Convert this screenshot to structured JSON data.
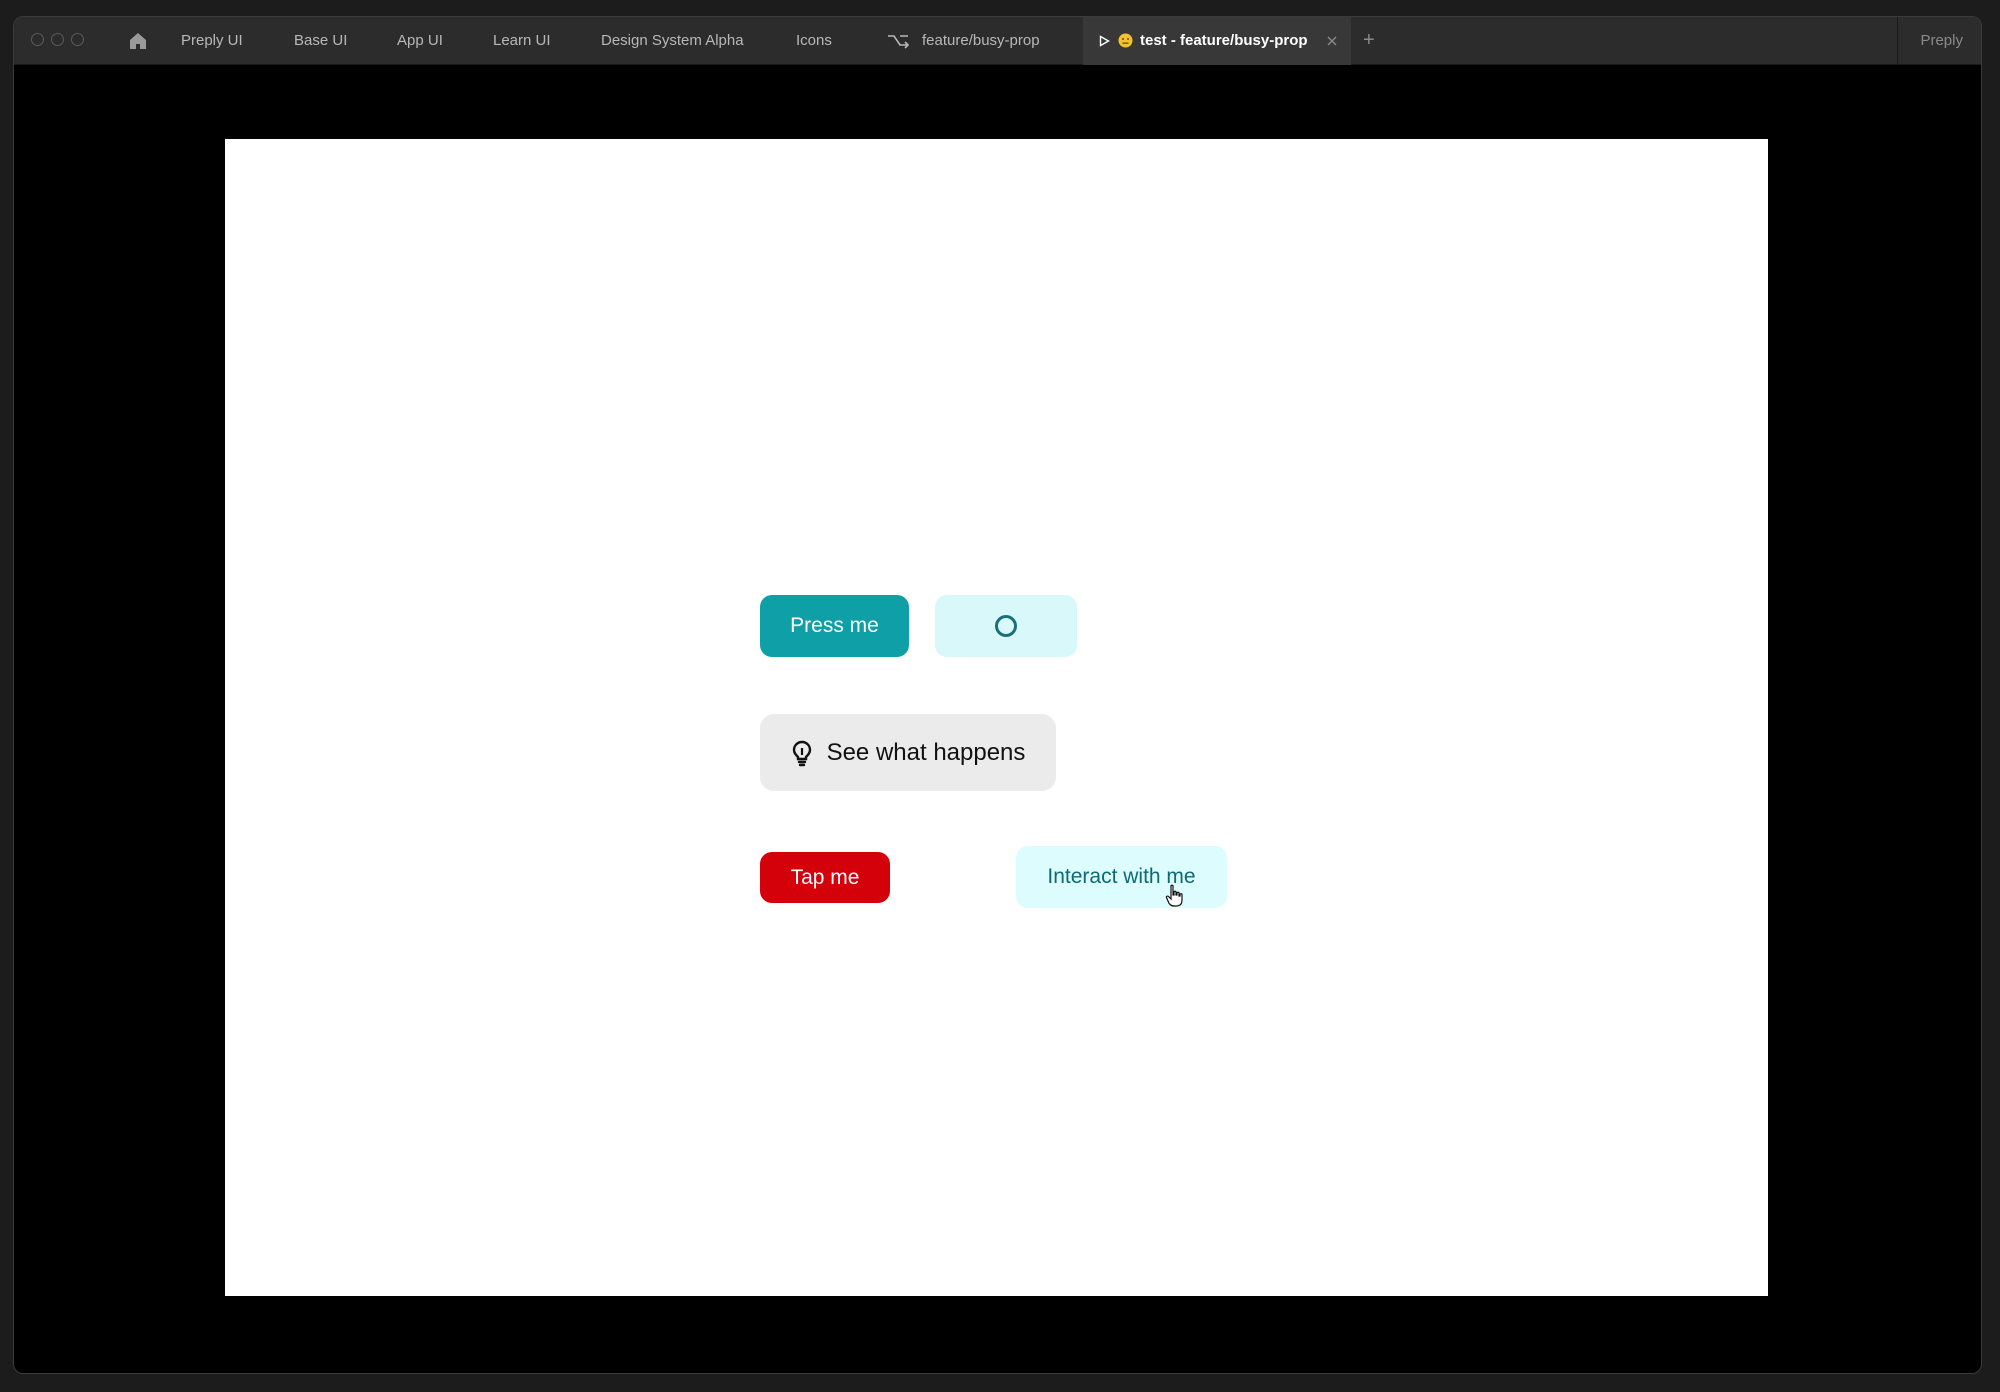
{
  "tabs": [
    {
      "label": "Preply UI"
    },
    {
      "label": "Base UI"
    },
    {
      "label": "App UI"
    },
    {
      "label": "Learn UI"
    },
    {
      "label": "Design System Alpha"
    },
    {
      "label": "Icons"
    },
    {
      "label": "feature/busy-prop",
      "icon": "branch-icon"
    }
  ],
  "active_tab": {
    "label": "test - feature/busy-prop",
    "icons": [
      "play-icon",
      "emoji-icon",
      "close-icon"
    ]
  },
  "new_tab_label": "+",
  "brand": "Preply",
  "prototype": {
    "press_button": "Press me",
    "loading_button": {
      "state": "busy",
      "icon": "spinner-icon"
    },
    "see_button": "See what happens",
    "see_icon": "lightbulb-icon",
    "tap_button": "Tap me",
    "interact_button": "Interact with me"
  },
  "colors": {
    "teal_primary": "#0fa0a7",
    "teal_light": "#d8f8fa",
    "danger_red": "#d4000a",
    "gray_button": "#ebebeb",
    "interact_text": "#0c6a74"
  }
}
